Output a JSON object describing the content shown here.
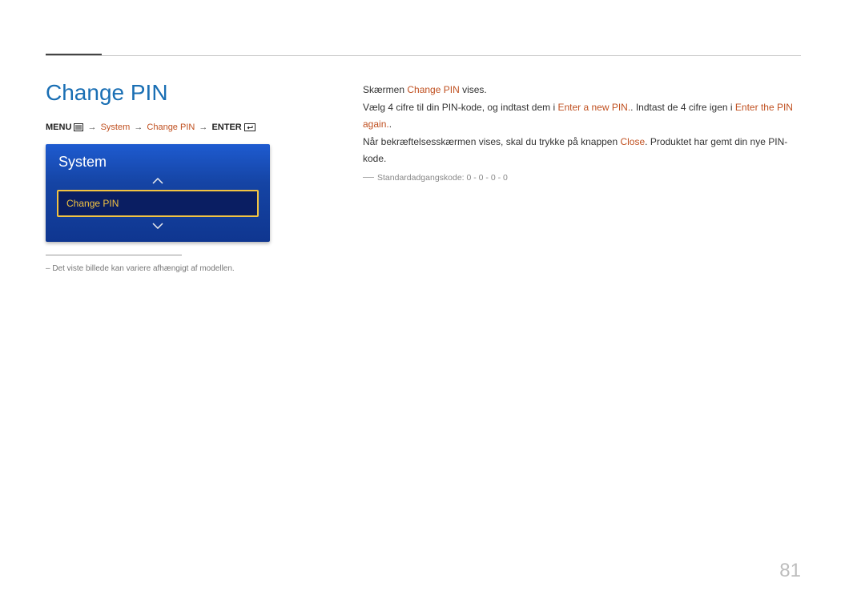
{
  "heading": "Change PIN",
  "breadcrumb": {
    "menu": "MENU",
    "system": "System",
    "change_pin": "Change PIN",
    "enter": "ENTER"
  },
  "panel": {
    "title": "System",
    "selected_item": "Change PIN"
  },
  "panel_note": "–  Det viste billede kan variere afhængigt af modellen.",
  "body": {
    "l1a": "Skærmen ",
    "l1b": "Change PIN",
    "l1c": " vises.",
    "l2a": "Vælg 4 cifre til din PIN-kode, og indtast dem i ",
    "l2b": "Enter a new PIN.",
    "l2c": ". Indtast de 4 cifre igen i ",
    "l2d": "Enter the PIN again.",
    "l2e": ".",
    "l3a": "Når bekræftelsesskærmen vises, skal du trykke på knappen ",
    "l3b": "Close",
    "l3c": ". Produktet har gemt din nye PIN-kode.",
    "sub": "Standardadgangskode: 0 - 0 - 0 - 0"
  },
  "page_number": "81"
}
